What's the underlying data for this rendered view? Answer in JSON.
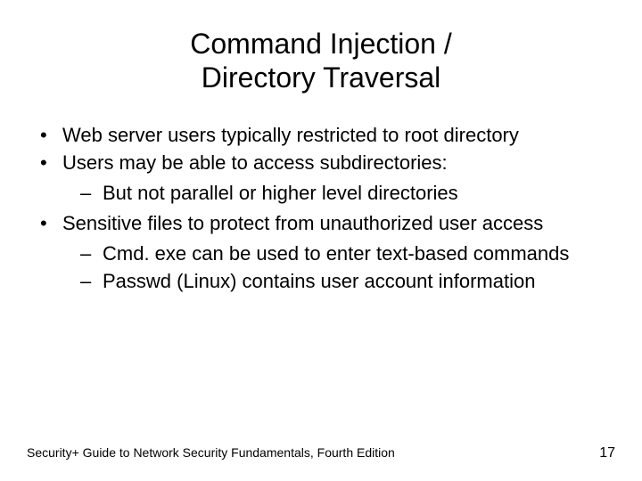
{
  "title_line1": "Command Injection /",
  "title_line2": "Directory Traversal",
  "bullets": {
    "b1": "Web server users typically restricted to root directory",
    "b2": "Users may be able to access subdirectories:",
    "b2_sub1": "But not parallel or higher level directories",
    "b3": "Sensitive files to protect from unauthorized user access",
    "b3_sub1": "Cmd. exe can be used to enter text-based commands",
    "b3_sub2": "Passwd (Linux) contains user account information"
  },
  "footer": {
    "left": "Security+ Guide to Network Security Fundamentals, Fourth Edition",
    "right": "17"
  }
}
